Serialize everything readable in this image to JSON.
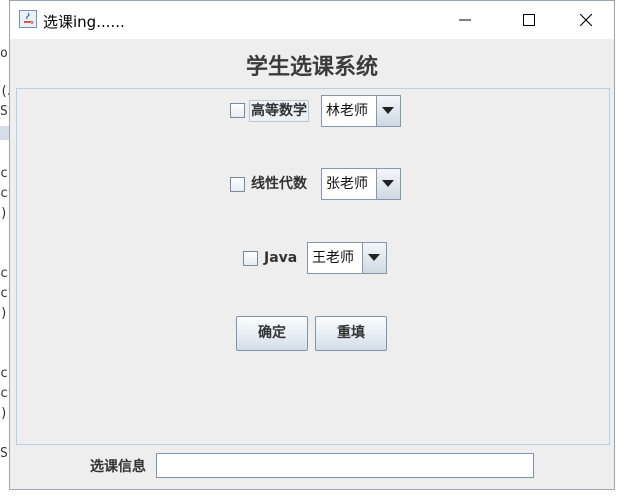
{
  "window": {
    "title": "选课ing......",
    "controls": {
      "minimize": "minimize-icon",
      "maximize": "maximize-icon",
      "close": "close-icon"
    }
  },
  "heading": "学生选课系统",
  "courses": [
    {
      "name": "高等数学",
      "checked": false,
      "teacher": "林老师"
    },
    {
      "name": "线性代数",
      "checked": false,
      "teacher": "张老师"
    },
    {
      "name": "Java",
      "checked": false,
      "teacher": "王老师"
    }
  ],
  "buttons": {
    "confirm": "确定",
    "reset": "重填"
  },
  "info": {
    "label": "选课信息",
    "value": ""
  },
  "background_fragments": [
    "or",
    "(A",
    "St",
    "c(",
    "ct",
    ") ;",
    "c(",
    "ct",
    ") ;",
    "c(",
    "ct",
    ") ;",
    "St"
  ]
}
